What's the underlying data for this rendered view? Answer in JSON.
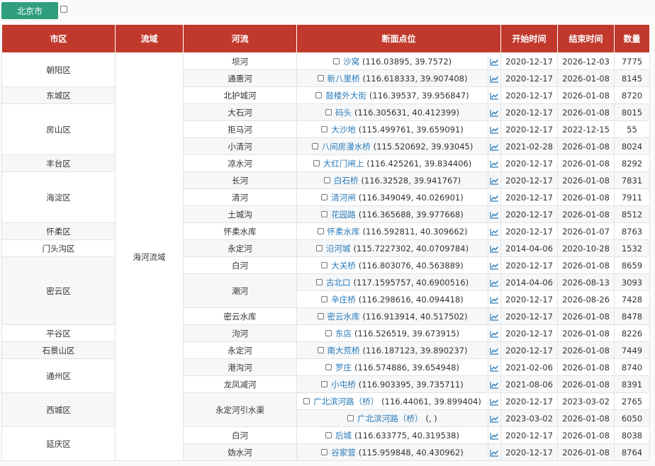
{
  "filter": {
    "city_label": "北京市"
  },
  "columns": [
    "市区",
    "流域",
    "河流",
    "断面点位",
    "",
    "开始时间",
    "结束时间",
    "数量"
  ],
  "basin": "海河流域",
  "districts": [
    {
      "name": "朝阳区",
      "rows": 2
    },
    {
      "name": "东城区",
      "rows": 1
    },
    {
      "name": "房山区",
      "rows": 3
    },
    {
      "name": "丰台区",
      "rows": 1
    },
    {
      "name": "海淀区",
      "rows": 3
    },
    {
      "name": "怀柔区",
      "rows": 1
    },
    {
      "name": "门头沟区",
      "rows": 1
    },
    {
      "name": "密云区",
      "rows": 4
    },
    {
      "name": "平谷区",
      "rows": 1
    },
    {
      "name": "石景山区",
      "rows": 1
    },
    {
      "name": "通州区",
      "rows": 2
    },
    {
      "name": "西城区",
      "rows": 2
    },
    {
      "name": "延庆区",
      "rows": 2
    }
  ],
  "rivers": [
    {
      "name": "坝河",
      "rows": 1
    },
    {
      "name": "通惠河",
      "rows": 1
    },
    {
      "name": "北护城河",
      "rows": 1
    },
    {
      "name": "大石河",
      "rows": 1
    },
    {
      "name": "拒马河",
      "rows": 1
    },
    {
      "name": "小清河",
      "rows": 1
    },
    {
      "name": "凉水河",
      "rows": 1
    },
    {
      "name": "长河",
      "rows": 1
    },
    {
      "name": "清河",
      "rows": 1
    },
    {
      "name": "土城沟",
      "rows": 1
    },
    {
      "name": "怀柔水库",
      "rows": 1
    },
    {
      "name": "永定河",
      "rows": 1
    },
    {
      "name": "白河",
      "rows": 1
    },
    {
      "name": "潮河",
      "rows": 2
    },
    {
      "name": "密云水库",
      "rows": 1
    },
    {
      "name": "泃河",
      "rows": 1
    },
    {
      "name": "永定河",
      "rows": 1
    },
    {
      "name": "港沟河",
      "rows": 1
    },
    {
      "name": "龙凤减河",
      "rows": 1
    },
    {
      "name": "永定河引水渠",
      "rows": 2
    },
    {
      "name": "白河",
      "rows": 1
    },
    {
      "name": "妫水河",
      "rows": 1
    }
  ],
  "rows": [
    {
      "point": "沙窝",
      "coord": "(116.03895, 39.7572)",
      "start": "2020-12-17",
      "end": "2026-12-03",
      "count": "7775"
    },
    {
      "point": "新八里桥",
      "coord": "(116.618333, 39.907408)",
      "start": "2020-12-17",
      "end": "2026-01-08",
      "count": "8145"
    },
    {
      "point": "鼓楼外大街",
      "coord": "(116.39537, 39.956847)",
      "start": "2020-12-17",
      "end": "2026-01-08",
      "count": "8720"
    },
    {
      "point": "码头",
      "coord": "(116.305631, 40.412399)",
      "start": "2020-12-17",
      "end": "2026-01-08",
      "count": "8015"
    },
    {
      "point": "大沙地",
      "coord": "(115.499761, 39.659091)",
      "start": "2020-12-17",
      "end": "2022-12-15",
      "count": "55"
    },
    {
      "point": "八间房漫水桥",
      "coord": "(115.520692, 39.93045)",
      "start": "2021-02-28",
      "end": "2026-01-08",
      "count": "8024"
    },
    {
      "point": "大红门闸上",
      "coord": "(116.425261, 39.834406)",
      "start": "2020-12-17",
      "end": "2026-01-08",
      "count": "8292"
    },
    {
      "point": "白石桥",
      "coord": "(116.32528, 39.941767)",
      "start": "2020-12-17",
      "end": "2026-01-08",
      "count": "7831"
    },
    {
      "point": "清河闸",
      "coord": "(116.349049, 40.026901)",
      "start": "2020-12-17",
      "end": "2026-01-08",
      "count": "7911"
    },
    {
      "point": "花园路",
      "coord": "(116.365688, 39.977668)",
      "start": "2020-12-17",
      "end": "2026-01-08",
      "count": "8512"
    },
    {
      "point": "怀柔水库",
      "coord": "(116.592811, 40.309662)",
      "start": "2020-12-17",
      "end": "2026-01-07",
      "count": "8763"
    },
    {
      "point": "沿河城",
      "coord": "(115.7227302, 40.0709784)",
      "start": "2014-04-06",
      "end": "2020-10-28",
      "count": "1532"
    },
    {
      "point": "大关桥",
      "coord": "(116.803076, 40.563889)",
      "start": "2020-12-17",
      "end": "2026-01-08",
      "count": "8659"
    },
    {
      "point": "古北口",
      "coord": "(117.1595757, 40.6900516)",
      "start": "2014-04-06",
      "end": "2026-08-13",
      "count": "3093"
    },
    {
      "point": "辛庄桥",
      "coord": "(116.298616, 40.094418)",
      "start": "2020-12-17",
      "end": "2026-08-26",
      "count": "7428"
    },
    {
      "point": "密云水库",
      "coord": "(116.913914, 40.517502)",
      "start": "2020-12-17",
      "end": "2026-01-08",
      "count": "8478"
    },
    {
      "point": "东店",
      "coord": "(116.526519, 39.673915)",
      "start": "2020-12-17",
      "end": "2026-01-08",
      "count": "8226"
    },
    {
      "point": "南大荒桥",
      "coord": "(116.187123, 39.890237)",
      "start": "2020-12-17",
      "end": "2026-01-08",
      "count": "7449"
    },
    {
      "point": "罗庄",
      "coord": "(116.574886, 39.654948)",
      "start": "2021-02-06",
      "end": "2026-01-08",
      "count": "8740"
    },
    {
      "point": "小屯桥",
      "coord": "(116.903395, 39.735711)",
      "start": "2021-08-06",
      "end": "2026-01-08",
      "count": "8391"
    },
    {
      "point": "广北滨河路（桥）",
      "coord": "(116.44061, 39.899404)",
      "start": "2020-12-17",
      "end": "2023-03-02",
      "count": "2765"
    },
    {
      "point": "广北滨河路（桥）",
      "coord": "(, )",
      "start": "2023-03-02",
      "end": "2026-01-08",
      "count": "6050"
    },
    {
      "point": "后城",
      "coord": "(116.633775, 40.319538)",
      "start": "2020-12-17",
      "end": "2026-01-08",
      "count": "8038"
    },
    {
      "point": "谷家营",
      "coord": "(115.959848, 40.430962)",
      "start": "2020-12-17",
      "end": "2026-01-08",
      "count": "8764"
    }
  ],
  "icons": {
    "checkbox": "checkbox-icon",
    "trend": "trend-chart-icon"
  },
  "colors": {
    "header_bg": "#c0392b",
    "tab_bg": "#2e9e7d",
    "link": "#2a7ab8"
  }
}
